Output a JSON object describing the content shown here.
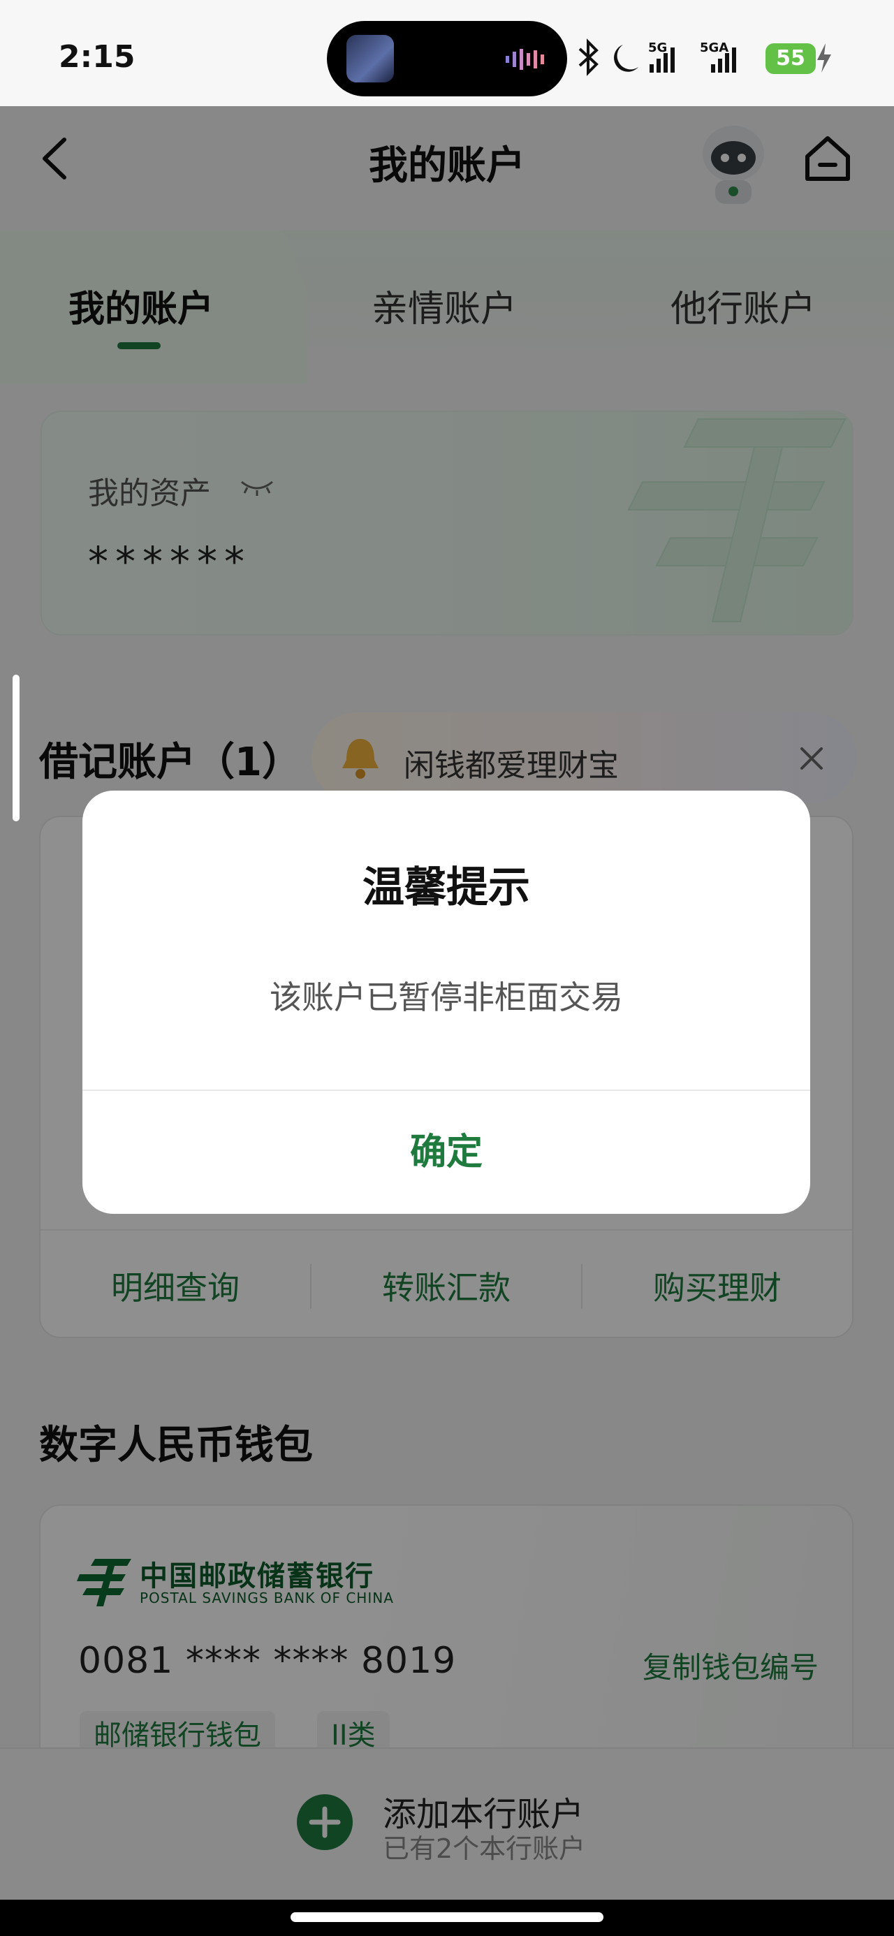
{
  "status_bar": {
    "time": "2:15",
    "signal_1": "5G",
    "signal_2": "5GA",
    "battery": "55"
  },
  "app_bar": {
    "title": "我的账户"
  },
  "tabs": [
    {
      "label": "我的账户",
      "active": true
    },
    {
      "label": "亲情账户",
      "active": false
    },
    {
      "label": "他行账户",
      "active": false
    }
  ],
  "assets": {
    "label": "我的资产",
    "value": "******"
  },
  "debit_section": {
    "title": "借记账户（1）",
    "promo_text": "闲钱都爱理财宝",
    "actions": [
      "明细查询",
      "转账汇款",
      "购买理财"
    ]
  },
  "wallet_section": {
    "title": "数字人民币钱包",
    "bank_name_cn": "中国邮政储蓄银行",
    "bank_name_en": "POSTAL SAVINGS BANK OF CHINA",
    "wallet_number": "0081 **** **** 8019",
    "copy_label": "复制钱包编号",
    "tags": [
      "邮储银行钱包",
      "II类"
    ]
  },
  "bottom_bar": {
    "add_label": "添加本行账户",
    "sub_label": "已有2个本行账户"
  },
  "dialog": {
    "title": "温馨提示",
    "message": "该账户已暂停非柜面交易",
    "confirm_label": "确定"
  },
  "colors": {
    "brand_green": "#1f7a3e",
    "battery_green": "#62c146",
    "overlay": "rgba(0,0,0,0.44)"
  }
}
